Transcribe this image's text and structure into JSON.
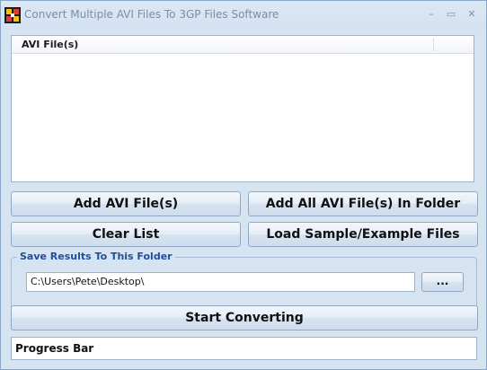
{
  "window": {
    "title": "Convert Multiple AVI Files To 3GP Files Software",
    "minimize_glyph": "–",
    "maximize_glyph": "▭",
    "close_glyph": "✕",
    "icon": "app-icon"
  },
  "file_list": {
    "column_header": "AVI File(s)",
    "items": []
  },
  "buttons": {
    "add_files": "Add AVI File(s)",
    "add_folder": "Add All AVI File(s) In Folder",
    "clear_list": "Clear List",
    "load_samples": "Load Sample/Example Files",
    "start_converting": "Start Converting"
  },
  "save_results": {
    "group_title": "Save Results To This Folder",
    "folder_path": "C:\\Users\\Pete\\Desktop\\",
    "browse_label": "..."
  },
  "progress": {
    "label": "Progress Bar"
  },
  "colors": {
    "window_background": "#d6e3f1",
    "group_title": "#1f4e9c"
  }
}
